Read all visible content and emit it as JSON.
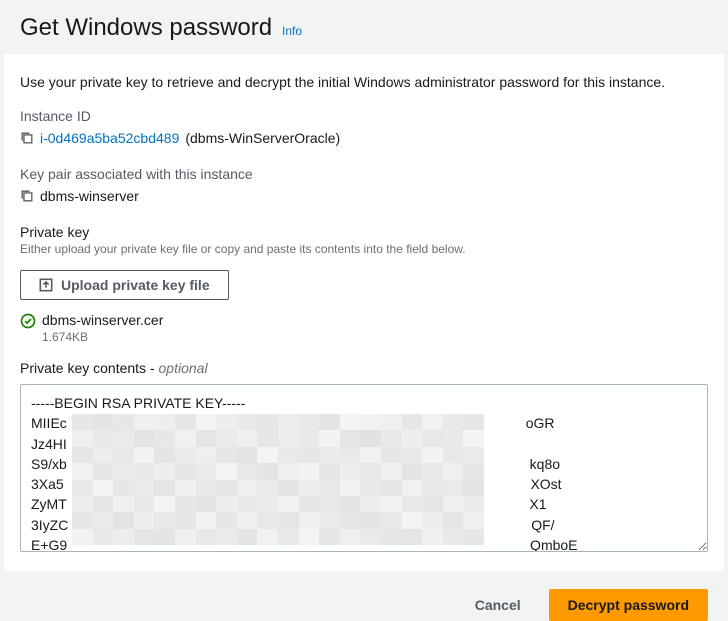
{
  "header": {
    "title": "Get Windows password",
    "info_label": "Info"
  },
  "panel": {
    "description": "Use your private key to retrieve and decrypt the initial Windows administrator password for this instance.",
    "instance_id_label": "Instance ID",
    "instance_id": "i-0d469a5ba52cbd489",
    "instance_name": "(dbms-WinServerOracle)",
    "keypair_label": "Key pair associated with this instance",
    "keypair_name": "dbms-winserver",
    "private_key_label": "Private key",
    "private_key_help": "Either upload your private key file or copy and paste its contents into the field below.",
    "upload_button_label": "Upload private key file",
    "uploaded_file_name": "dbms-winserver.cer",
    "uploaded_file_size": "1.674KB",
    "contents_label": "Private key contents - ",
    "contents_optional": "optional",
    "key_contents": "-----BEGIN RSA PRIVATE KEY-----\nMIIEc                                                                                                                      oGR\nJz4HI\nS9/xb                                                                                                                       kq8o\n3Xa5                                                                                                                        XOst\nZyMT                                                                                                                       X1\n3IyZC                                                                                                                       QF/\nE+G9                                                                                                                       QmboE"
  },
  "footer": {
    "cancel_label": "Cancel",
    "decrypt_label": "Decrypt password"
  }
}
